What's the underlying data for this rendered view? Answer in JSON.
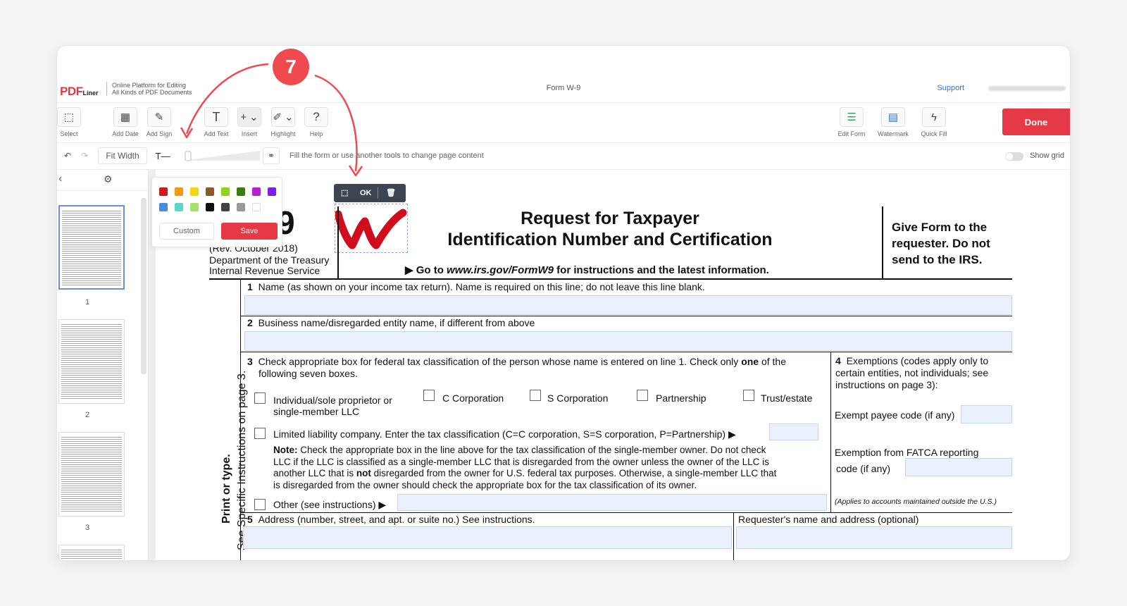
{
  "header": {
    "logo_main": "PDF",
    "logo_sub": "Liner",
    "tagline_1": "Online Platform for Editing",
    "tagline_2": "All Kinds of PDF Documents",
    "doc_title": "Form W-9",
    "support": "Support"
  },
  "toolbar": {
    "select": "Select",
    "add_date": "Add Date",
    "add_sign": "Add Sign",
    "add_text": "Add Text",
    "insert": "Insert",
    "highlight": "Highlight",
    "help": "Help",
    "edit_form": "Edit Form",
    "watermark": "Watermark",
    "quick_fill": "Quick Fill",
    "done": "Done"
  },
  "subtoolbar": {
    "fit_width": "Fit Width",
    "text_tool": "T—",
    "hint": "Fill the form or use another tools to change page content",
    "show_grid": "Show grid"
  },
  "palette": {
    "colors": [
      "#cc1a1a",
      "#f29a11",
      "#f3d511",
      "#8b5a2b",
      "#8fd21a",
      "#3f7a10",
      "#b81dcf",
      "#7b1ee6",
      "#4a8bdb",
      "#5fd6c8",
      "#a9e06b",
      "#111111",
      "#444444",
      "#9a9a9a",
      "#ffffff"
    ],
    "custom": "Custom",
    "save": "Save"
  },
  "pages": {
    "thumbs": [
      "1",
      "2",
      "3"
    ]
  },
  "signature": {
    "ok": "OK",
    "letter": "W"
  },
  "badge": "7",
  "form": {
    "form_no": "9",
    "rev": "(Rev. October 2018)",
    "dept": "Department of the Treasury",
    "irs": "Internal Revenue Service",
    "title_1": "Request for Taxpayer",
    "title_2": "Identification Number and Certification",
    "goto_prefix": "▶ Go to ",
    "goto_url": "www.irs.gov/FormW9",
    "goto_suffix": " for instructions and the latest information.",
    "give_1": "Give Form to the",
    "give_2": "requester. Do not",
    "give_3": "send to the IRS.",
    "side_1": "Print or type.",
    "side_2": "See Specific Instructions on page 3.",
    "line1_num": "1",
    "line1": "Name (as shown on your income tax return). Name is required on this line; do not leave this line blank.",
    "line2_num": "2",
    "line2": "Business name/disregarded entity name, if different from above",
    "line3_num": "3",
    "line3a_pre": "Check appropriate box for federal tax classification of the person whose name is entered on line 1. Check only ",
    "line3a_bold": "one",
    "line3a_post": " of the",
    "line3b": "following seven boxes.",
    "indiv_1": "Individual/sole proprietor or",
    "indiv_2": "single-member LLC",
    "c_corp": "C Corporation",
    "s_corp": "S Corporation",
    "partnership": "Partnership",
    "trust": "Trust/estate",
    "llc": "Limited liability company. Enter the tax classification (C=C corporation, S=S corporation, P=Partnership) ▶",
    "note_label": "Note:",
    "note_1": " Check the appropriate box in the line above for the tax classification of the single-member owner.  Do not check",
    "note_2": "LLC if the LLC is classified as a single-member LLC that is disregarded from the owner unless the owner of the LLC is",
    "note_3_pre": "another LLC that is ",
    "note_3_bold": "not",
    "note_3_post": " disregarded from the owner for U.S. federal tax purposes. Otherwise, a single-member LLC that",
    "note_4": "is disregarded from the owner should check the appropriate box for the tax classification of its owner.",
    "other": "Other (see instructions) ▶",
    "ex_num": "4",
    "ex_1": "Exemptions (codes apply only to",
    "ex_2": "certain entities, not individuals; see",
    "ex_3": "instructions on page 3):",
    "exempt_payee": "Exempt payee code (if any)",
    "fatca_1": "Exemption from FATCA reporting",
    "fatca_2": "code (if any)",
    "applies": "(Applies to accounts maintained outside the U.S.)",
    "line5_num": "5",
    "line5": "Address (number, street, and apt. or suite no.) See instructions.",
    "requester": "Requester's name and address (optional)"
  }
}
